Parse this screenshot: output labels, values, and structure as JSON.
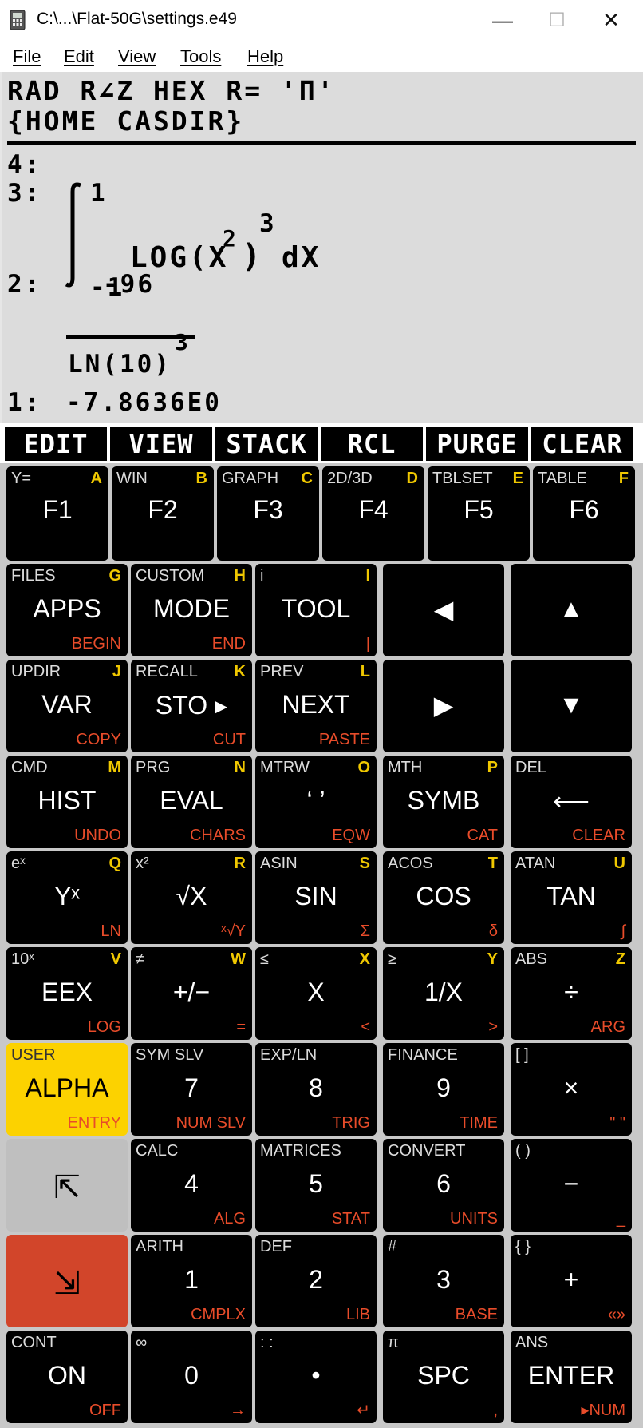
{
  "window": {
    "title": "C:\\...\\Flat-50G\\settings.e49",
    "minimize": "—",
    "maximize": "☐",
    "close": "✕"
  },
  "menu": [
    "File",
    "Edit",
    "View",
    "Tools",
    "Help"
  ],
  "lcd": {
    "status1": "RAD R∠Z HEX R= 'Π'",
    "status2": "{HOME CASDIR}",
    "level4": "4:",
    "level3": "3:",
    "level2": "2:",
    "level1": "1:",
    "integral_upper": "1",
    "integral_lower": "-1",
    "integrand": "LOG(X",
    "exp2": "2",
    "close_paren": ")",
    "exp3": "3",
    "dx": "dX",
    "numerator": "-96",
    "denominator": "LN(10)",
    "den_exp": "3",
    "result": "-7.8636E0"
  },
  "softkeys": [
    "EDIT",
    "VIEW",
    "STACK",
    "RCL",
    "PURGE",
    "CLEAR"
  ],
  "keys": [
    [
      {
        "tl": "Y=",
        "tr": "A",
        "main": "F1",
        "br": ""
      },
      {
        "tl": "WIN",
        "tr": "B",
        "main": "F2",
        "br": ""
      },
      {
        "tl": "GRAPH",
        "tr": "C",
        "main": "F3",
        "br": ""
      },
      {
        "tl": "2D/3D",
        "tr": "D",
        "main": "F4",
        "br": ""
      },
      {
        "tl": "TBLSET",
        "tr": "E",
        "main": "F5",
        "br": ""
      },
      {
        "tl": "TABLE",
        "tr": "F",
        "main": "F6",
        "br": ""
      }
    ],
    [
      {
        "tl": "FILES",
        "tr": "G",
        "main": "APPS",
        "br": "BEGIN"
      },
      {
        "tl": "CUSTOM",
        "tr": "H",
        "main": "MODE",
        "br": "END"
      },
      {
        "tl": "i",
        "tr": "I",
        "main": "TOOL",
        "br": "|"
      },
      {
        "tl": "",
        "tr": "",
        "main": "◀",
        "br": ""
      },
      {
        "tl": "",
        "tr": "",
        "main": "▲",
        "br": ""
      }
    ],
    [
      {
        "tl": "UPDIR",
        "tr": "J",
        "main": "VAR",
        "br": "COPY"
      },
      {
        "tl": "RECALL",
        "tr": "K",
        "main": "STO ▸",
        "br": "CUT"
      },
      {
        "tl": "PREV",
        "tr": "L",
        "main": "NEXT",
        "br": "PASTE"
      },
      {
        "tl": "",
        "tr": "",
        "main": "▶",
        "br": ""
      },
      {
        "tl": "",
        "tr": "",
        "main": "▼",
        "br": ""
      }
    ],
    [
      {
        "tl": "CMD",
        "tr": "M",
        "main": "HIST",
        "br": "UNDO"
      },
      {
        "tl": "PRG",
        "tr": "N",
        "main": "EVAL",
        "br": "CHARS"
      },
      {
        "tl": "MTRW",
        "tr": "O",
        "main": "‘ ’",
        "br": "EQW"
      },
      {
        "tl": "MTH",
        "tr": "P",
        "main": "SYMB",
        "br": "CAT"
      },
      {
        "tl": "DEL",
        "tr": "",
        "main": "⟵",
        "br": "CLEAR"
      }
    ],
    [
      {
        "tl": "eˣ",
        "tr": "Q",
        "main": "Yˣ",
        "br": "LN"
      },
      {
        "tl": "x²",
        "tr": "R",
        "main": "√X",
        "br": "ˣ√Y"
      },
      {
        "tl": "ASIN",
        "tr": "S",
        "main": "SIN",
        "br": "Σ"
      },
      {
        "tl": "ACOS",
        "tr": "T",
        "main": "COS",
        "br": "δ"
      },
      {
        "tl": "ATAN",
        "tr": "U",
        "main": "TAN",
        "br": "∫"
      }
    ],
    [
      {
        "tl": "10ˣ",
        "tr": "V",
        "main": "EEX",
        "br": "LOG"
      },
      {
        "tl": "≠",
        "tr": "W",
        "main": "+/−",
        "br": "="
      },
      {
        "tl": "≤",
        "tr": "X",
        "main": "X",
        "br": "<"
      },
      {
        "tl": "≥",
        "tr": "Y",
        "main": "1/X",
        "br": ">"
      },
      {
        "tl": "ABS",
        "tr": "Z",
        "main": "÷",
        "br": "ARG"
      }
    ],
    [
      {
        "tl": "USER",
        "tr": "",
        "main": "ALPHA",
        "br": "ENTRY"
      },
      {
        "tl": "SYM SLV",
        "tr": "",
        "main": "7",
        "br": "NUM SLV"
      },
      {
        "tl": "EXP/LN",
        "tr": "",
        "main": "8",
        "br": "TRIG"
      },
      {
        "tl": "FINANCE",
        "tr": "",
        "main": "9",
        "br": "TIME"
      },
      {
        "tl": "[ ]",
        "tr": "",
        "main": "×",
        "br": "\" \""
      }
    ],
    [
      {
        "tl": "",
        "tr": "",
        "main": "⇱",
        "br": ""
      },
      {
        "tl": "CALC",
        "tr": "",
        "main": "4",
        "br": "ALG"
      },
      {
        "tl": "MATRICES",
        "tr": "",
        "main": "5",
        "br": "STAT"
      },
      {
        "tl": "CONVERT",
        "tr": "",
        "main": "6",
        "br": "UNITS"
      },
      {
        "tl": "( )",
        "tr": "",
        "main": "−",
        "br": "_"
      }
    ],
    [
      {
        "tl": "",
        "tr": "",
        "main": "⇲",
        "br": ""
      },
      {
        "tl": "ARITH",
        "tr": "",
        "main": "1",
        "br": "CMPLX"
      },
      {
        "tl": "DEF",
        "tr": "",
        "main": "2",
        "br": "LIB"
      },
      {
        "tl": "#",
        "tr": "",
        "main": "3",
        "br": "BASE"
      },
      {
        "tl": "{ }",
        "tr": "",
        "main": "+",
        "br": "«»"
      }
    ],
    [
      {
        "tl": "CONT",
        "tr": "",
        "main": "ON",
        "br": "OFF"
      },
      {
        "tl": "∞",
        "tr": "",
        "main": "0",
        "br": "→"
      },
      {
        "tl": ": :",
        "tr": "",
        "main": "•",
        "br": "↵"
      },
      {
        "tl": "π",
        "tr": "",
        "main": "SPC",
        "br": ","
      },
      {
        "tl": "ANS",
        "tr": "",
        "main": "ENTER",
        "br": "▸NUM"
      }
    ]
  ],
  "colors": {
    "alpha": "#fcd200",
    "leftshift": "#bfbfbf",
    "rightshift": "#d2452a",
    "alpha_label": "#f0c800",
    "rightshift_label": "#e84c2a"
  }
}
